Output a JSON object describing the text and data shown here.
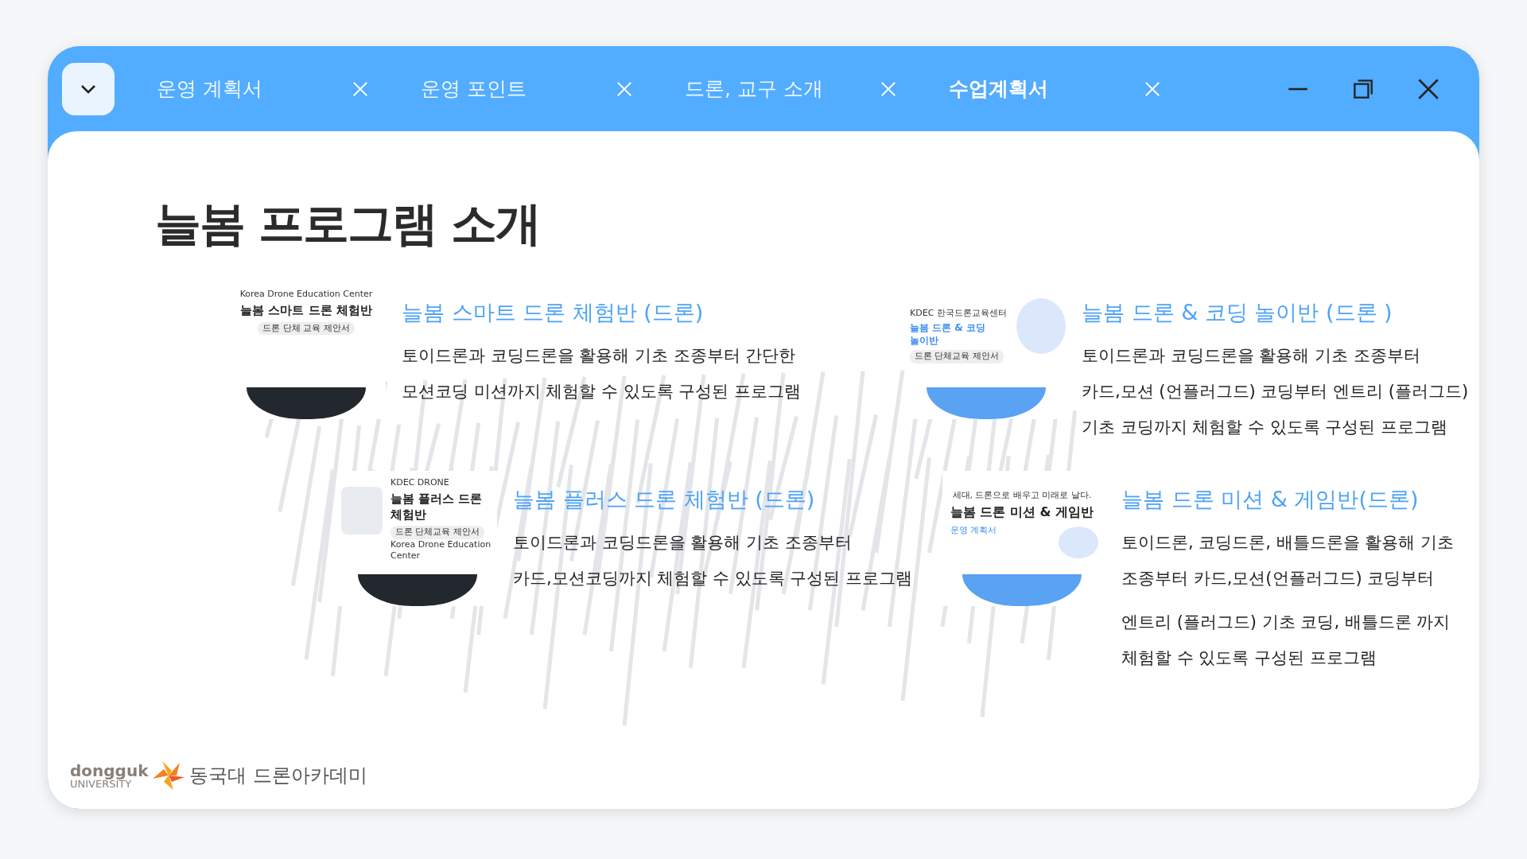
{
  "tabs": [
    {
      "label": "운영 계획서",
      "selected": false
    },
    {
      "label": "운영 포인트",
      "selected": false
    },
    {
      "label": "드론, 교구 소개",
      "selected": false
    },
    {
      "label": "수업계획서",
      "selected": true
    }
  ],
  "page_title": "늘봄 프로그램 소개",
  "programs": [
    {
      "title": "늘봄 스마트 드론 체험반 (드론)",
      "description": [
        "토이드론과 코딩드론을 활용해 기초 조종부터 간단한",
        "모션코딩 미션까지 체험할 수 있도록 구성된  프로그램"
      ],
      "cover": {
        "kind": "center",
        "color": "#23272e",
        "lines": [
          "Korea Drone Education Center",
          "늘봄 스마트 드론 체험반",
          "드론 단체 교육 제안서"
        ]
      }
    },
    {
      "title": "늘봄 드론 & 코딩 놀이반 (드론 )",
      "description": [
        "토이드론과 코딩드론을 활용해 기초 조종부터",
        "카드,모션 (언플러그드) 코딩부터 엔트리 (플러그드)",
        "기초 코딩까지 체험할 수 있도록 구성된  프로그램"
      ],
      "cover": {
        "kind": "kids",
        "color": "#5aa2f2",
        "lines": [
          "KDEC 한국드론교육센터",
          "늘봄 드론 & 코딩 놀이반",
          "드론 단체교육 제안서"
        ]
      }
    },
    {
      "title": "늘봄 플러스 드론 체험반 (드론)",
      "description": [
        "토이드론과 코딩드론을 활용해 기초 조종부터",
        "카드,모션코딩까지 체험할 수 있도록 구성된  프로그램"
      ],
      "cover": {
        "kind": "equipment",
        "color": "#23272e",
        "lines": [
          "KDEC DRONE",
          "늘봄 플러스 드론 체험반",
          "드론 단체교육 제안서",
          "Korea Drone Education Center"
        ]
      }
    },
    {
      "title": "늘봄 드론 미션 & 게임반(드론)",
      "description": [
        "토이드론, 코딩드론, 배틀드론을 활용해 기초",
        "조종부터 카드,모션(언플러그드) 코딩부터",
        "엔트리 (플러그드) 기초 코딩, 배틀드론 까지",
        "체험할 수 있도록 구성된  프로그램"
      ],
      "cover": {
        "kind": "flyer",
        "color": "#5aa2f2",
        "lines": [
          "세대, 드론으로 배우고 미래로 날다.",
          "늘봄 드론 미션 & 게임반",
          "운영 계획서"
        ]
      }
    }
  ],
  "footer": {
    "logo_word": "dongguk",
    "logo_sub": "UNIVERSITY",
    "academy": "동국대 드론아카데미"
  }
}
